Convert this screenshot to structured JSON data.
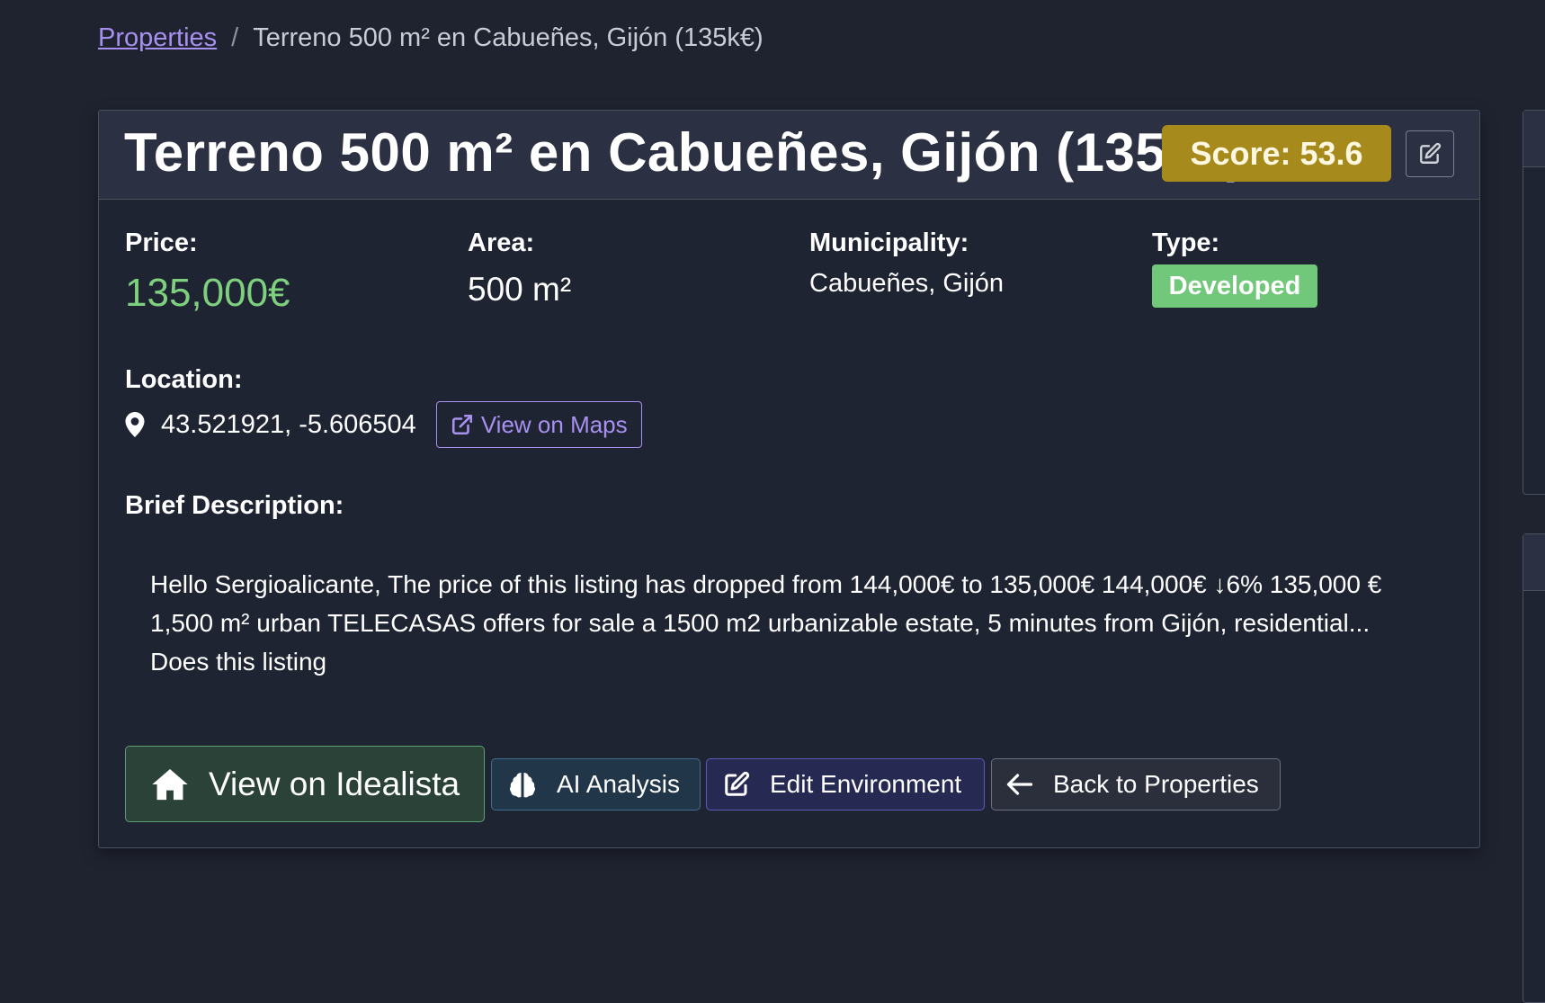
{
  "breadcrumb": {
    "link_label": "Properties",
    "separator": "/",
    "current": "Terreno 500 m² en Cabueñes, Gijón (135k€)"
  },
  "header": {
    "title": "Terreno 500 m² en Cabueñes, Gijón (135k€)",
    "score_label": "Score: 53.6"
  },
  "details": {
    "price_label": "Price:",
    "price_value": "135,000€",
    "area_label": "Area:",
    "area_value": "500 m²",
    "municipality_label": "Municipality:",
    "municipality_value": "Cabueñes, Gijón",
    "type_label": "Type:",
    "type_value": "Developed"
  },
  "location": {
    "label": "Location:",
    "coords": "43.521921, -5.606504",
    "maps_button": "View on Maps"
  },
  "description": {
    "label": "Brief Description:",
    "text": "Hello Sergioalicante, The price of this listing has dropped from 144,000€ to 135,000€ 144,000€ ↓6% 135,000 € 1,500 m² urban TELECASAS offers for sale a 1500 m2 urbanizable estate, 5 minutes from Gijón, residential... Does this listing"
  },
  "actions": {
    "idealista": "View on Idealista",
    "ai_analysis": "AI Analysis",
    "edit_environment": "Edit Environment",
    "back": "Back to Properties"
  },
  "icons": {
    "edit": "pencil-square-icon",
    "location": "map-pin-icon",
    "external": "external-link-icon",
    "home": "home-icon",
    "brain": "brain-icon",
    "back": "arrow-left-icon"
  },
  "colors": {
    "background": "#1f2330",
    "accent_link": "#a890f0",
    "price": "#7ed07f",
    "score_badge": "#a68b1c",
    "type_badge": "#72c87a"
  }
}
